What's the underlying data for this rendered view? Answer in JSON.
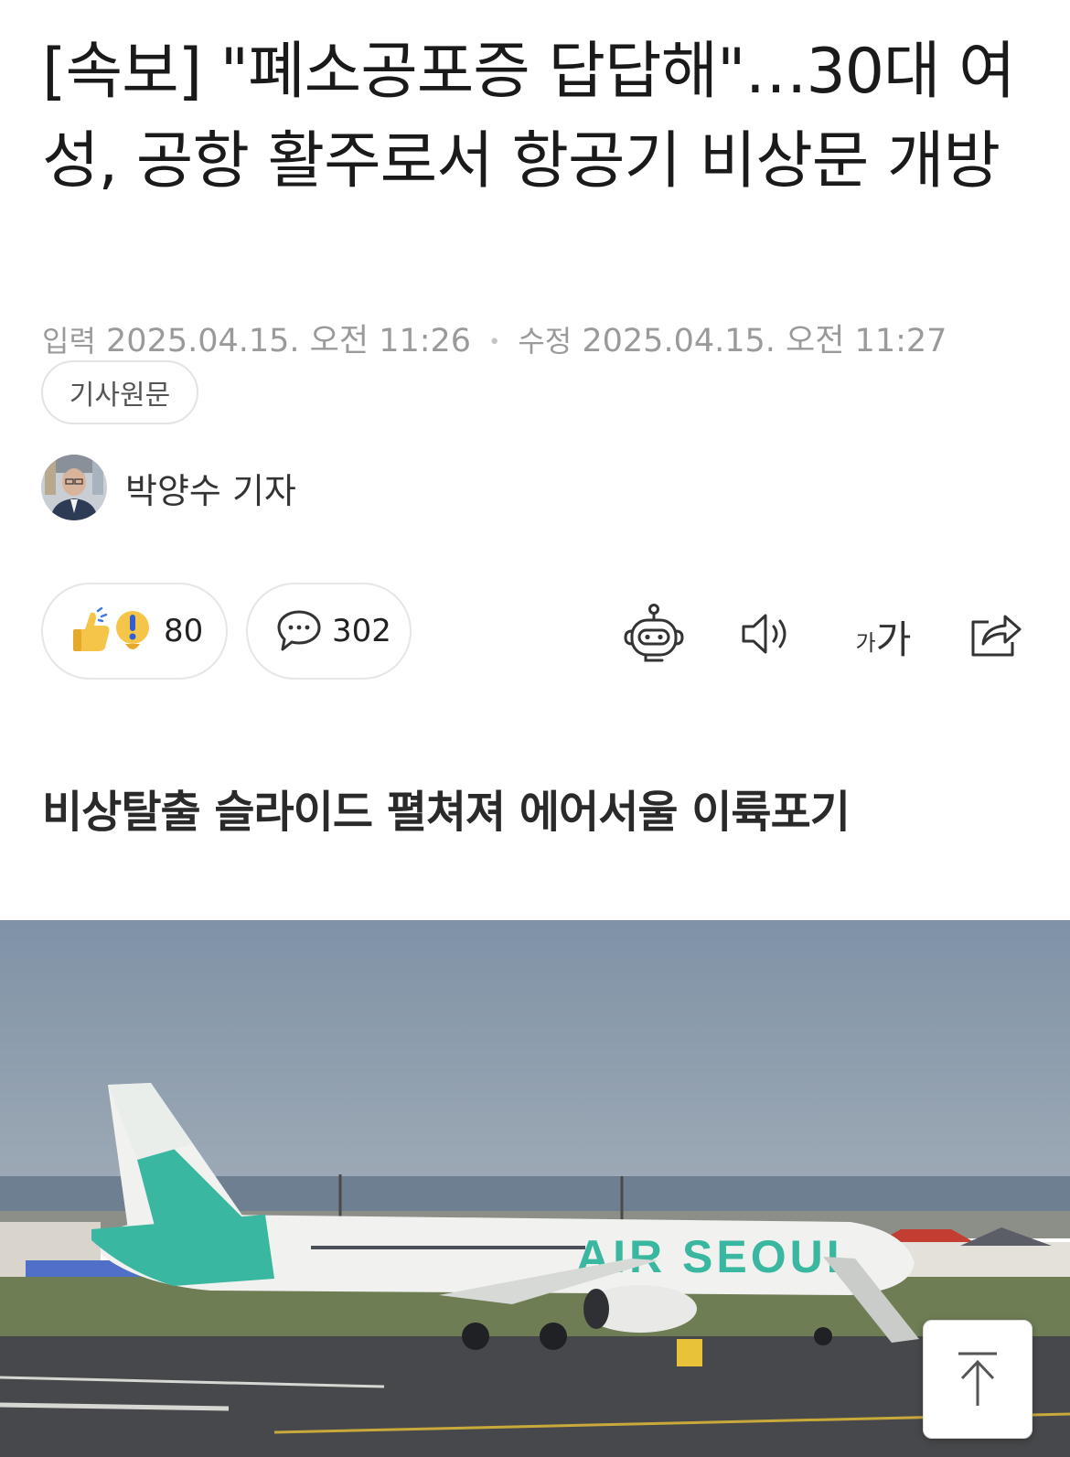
{
  "article": {
    "headline": "[속보] \"폐소공포증 답답해\"…30대 여성, 공항 활주로서 항공기 비상문 개방",
    "meta": {
      "input_label": "입력",
      "input_time": "2025.04.15. 오전 11:26",
      "separator": "•",
      "modified_label": "수정",
      "modified_time": "2025.04.15. 오전 11:27"
    },
    "source_button": "기사원문",
    "author": "박양수 기자",
    "subheadline": "비상탈출 슬라이드 펼쳐져 에어서울 이륙포기"
  },
  "actions": {
    "reaction_count": "80",
    "comment_count": "302",
    "font_size_label_small": "가",
    "font_size_label_large": "가"
  },
  "photo": {
    "plane_livery": "AIR SEOUL",
    "colors": {
      "sky": "#7e91a4",
      "tarmac": "#46474a",
      "livery_mint": "#3ab7a0"
    }
  }
}
